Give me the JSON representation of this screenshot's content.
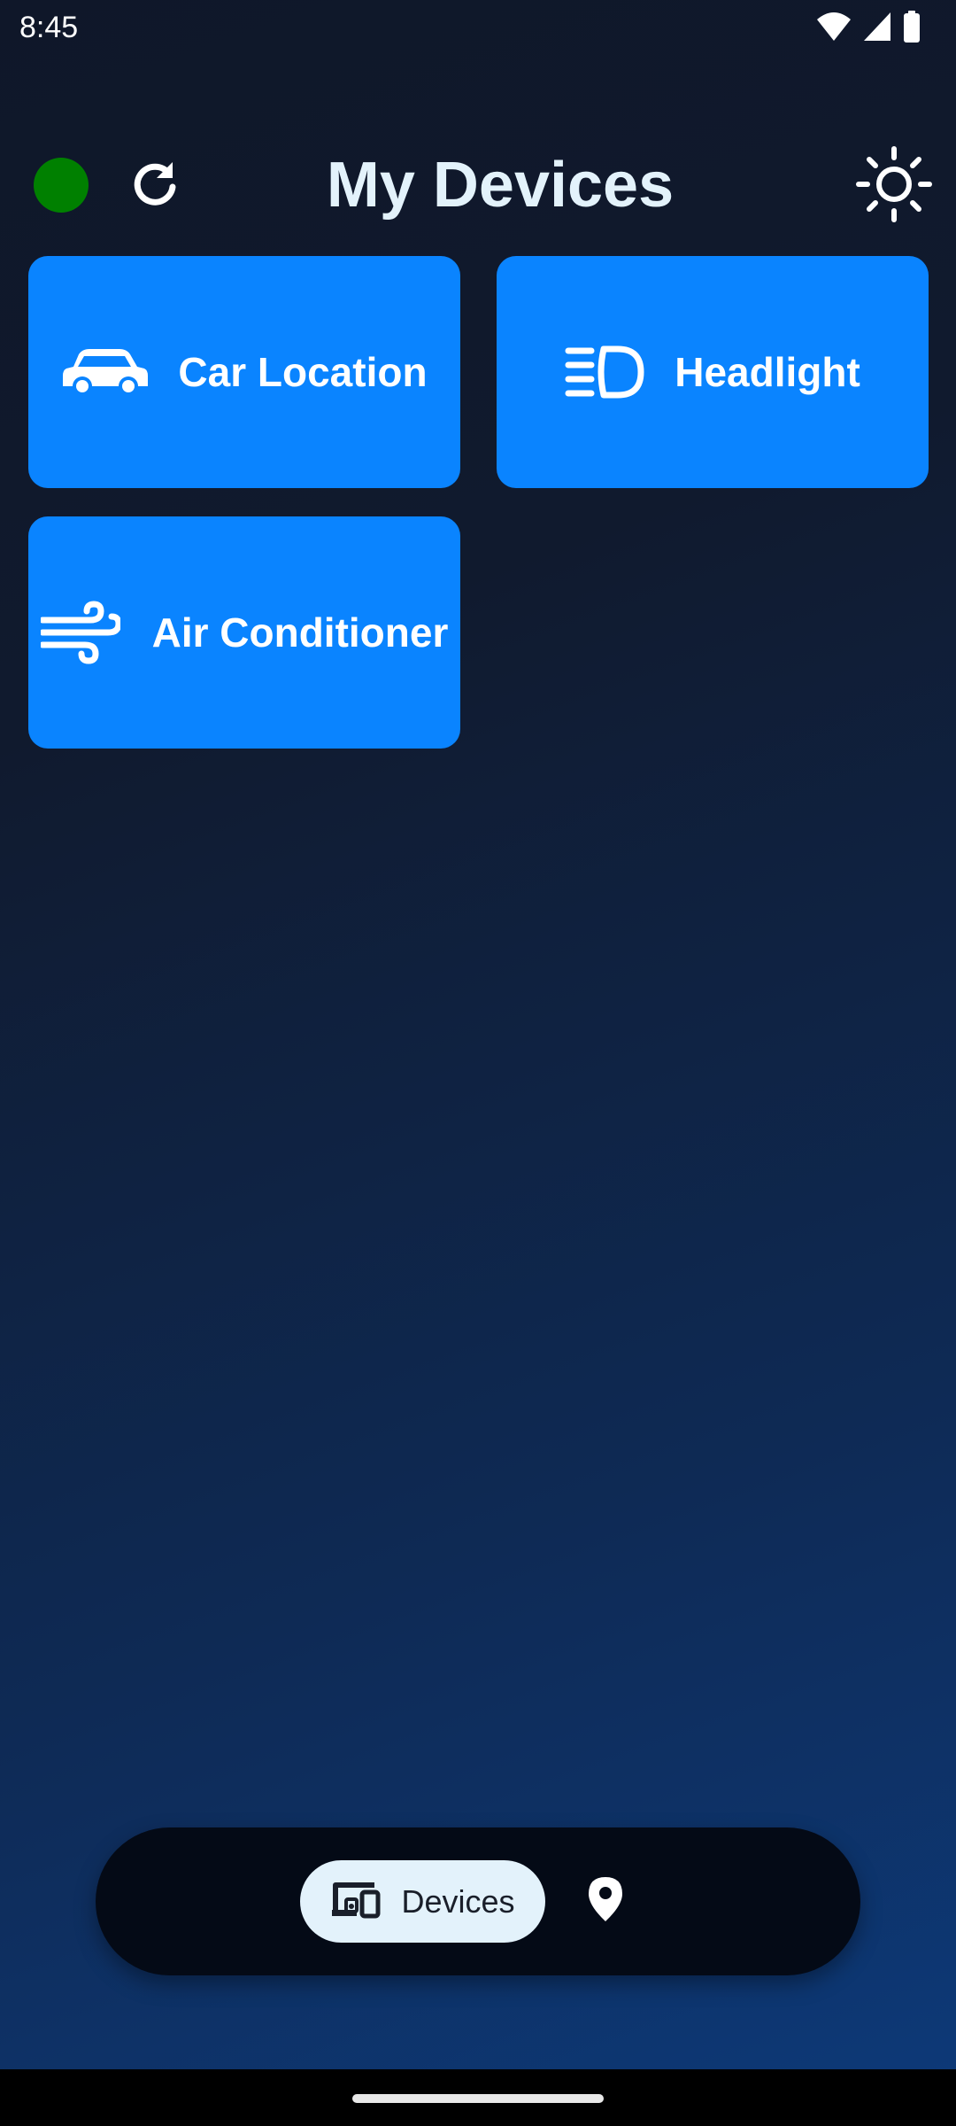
{
  "status_bar": {
    "time": "8:45",
    "icons": [
      "wifi-icon",
      "cellular-signal-icon",
      "battery-icon"
    ]
  },
  "header": {
    "title": "My Devices",
    "connection_status_color": "#008000",
    "icons": [
      "refresh-icon",
      "brightness-icon"
    ]
  },
  "devices": [
    {
      "label": "Car Location",
      "icon": "car-icon"
    },
    {
      "label": "Headlight",
      "icon": "headlight-icon"
    },
    {
      "label": "Air Conditioner",
      "icon": "wind-icon"
    }
  ],
  "bottom_nav": {
    "devices_label": "Devices",
    "devices_icon": "devices-icon",
    "location_icon": "location-pin-icon"
  },
  "colors": {
    "tile": "#0a84ff",
    "title": "#e3f2fb",
    "nav_bar": "#040a16",
    "nav_active_pill": "#e3f2fb"
  }
}
